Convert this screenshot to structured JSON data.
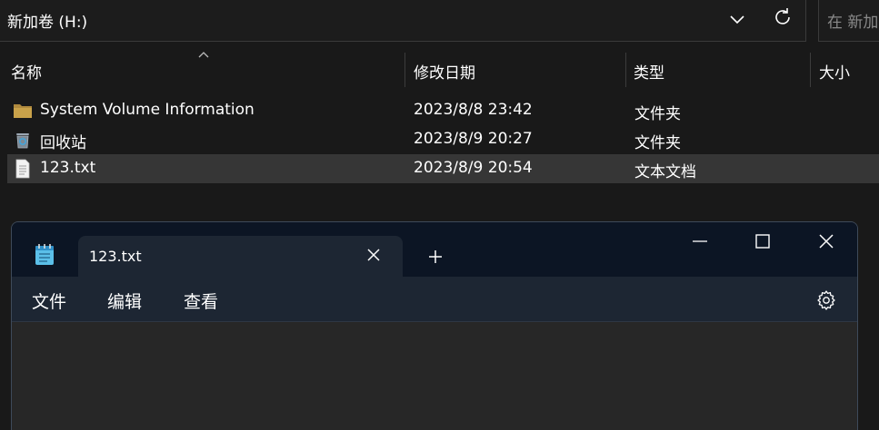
{
  "explorer": {
    "address": "新加卷 (H:)",
    "search_placeholder": "在 新加",
    "columns": {
      "name": "名称",
      "date": "修改日期",
      "type": "类型",
      "size": "大小"
    },
    "files": [
      {
        "name": "System Volume Information",
        "date": "2023/8/8 23:42",
        "type": "文件夹",
        "icon": "folder-icon"
      },
      {
        "name": "回收站",
        "date": "2023/8/9 20:27",
        "type": "文件夹",
        "icon": "recycle-bin-icon"
      },
      {
        "name": "123.txt",
        "date": "2023/8/9 20:54",
        "type": "文本文档",
        "icon": "text-file-icon"
      }
    ]
  },
  "notepad": {
    "tab_title": "123.txt",
    "menu": {
      "file": "文件",
      "edit": "编辑",
      "view": "查看"
    },
    "content": ""
  },
  "colors": {
    "folder": "#c9a24a",
    "selection": "#363636",
    "titlebar": "#0c1524",
    "tab": "#1d2633"
  }
}
